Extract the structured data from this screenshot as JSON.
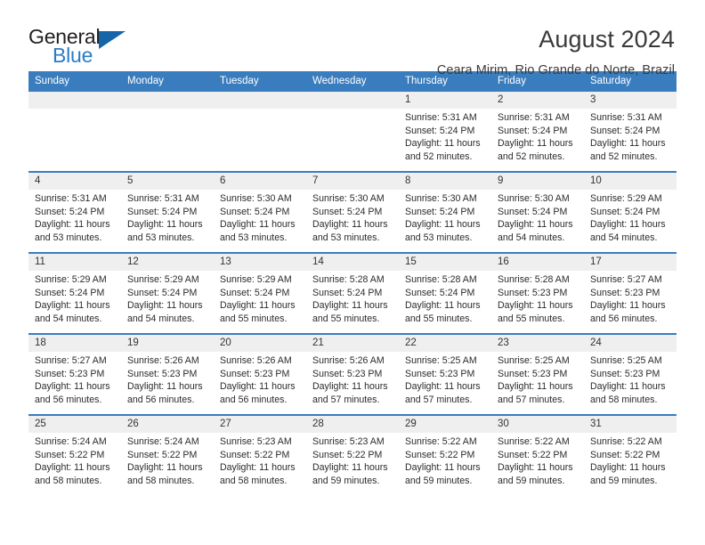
{
  "logo": {
    "word_one": "General",
    "word_two": "Blue",
    "triangle_icon": "triangle-icon",
    "brand_dark": "#231f20",
    "brand_blue": "#2b7cc4"
  },
  "header": {
    "title": "August 2024",
    "subtitle": "Ceara Mirim, Rio Grande do Norte, Brazil"
  },
  "theme": {
    "header_blue": "#3a7dbf",
    "day_band_gray": "#efefef",
    "text": "#2b2b2b"
  },
  "calendar": {
    "weekdays": [
      "Sunday",
      "Monday",
      "Tuesday",
      "Wednesday",
      "Thursday",
      "Friday",
      "Saturday"
    ],
    "weeks": [
      [
        {
          "day": "",
          "empty": true,
          "lines": []
        },
        {
          "day": "",
          "empty": true,
          "lines": []
        },
        {
          "day": "",
          "empty": true,
          "lines": []
        },
        {
          "day": "",
          "empty": true,
          "lines": []
        },
        {
          "day": "1",
          "empty": false,
          "lines": [
            "Sunrise: 5:31 AM",
            "Sunset: 5:24 PM",
            "Daylight: 11 hours",
            "and 52 minutes."
          ]
        },
        {
          "day": "2",
          "empty": false,
          "lines": [
            "Sunrise: 5:31 AM",
            "Sunset: 5:24 PM",
            "Daylight: 11 hours",
            "and 52 minutes."
          ]
        },
        {
          "day": "3",
          "empty": false,
          "lines": [
            "Sunrise: 5:31 AM",
            "Sunset: 5:24 PM",
            "Daylight: 11 hours",
            "and 52 minutes."
          ]
        }
      ],
      [
        {
          "day": "4",
          "empty": false,
          "lines": [
            "Sunrise: 5:31 AM",
            "Sunset: 5:24 PM",
            "Daylight: 11 hours",
            "and 53 minutes."
          ]
        },
        {
          "day": "5",
          "empty": false,
          "lines": [
            "Sunrise: 5:31 AM",
            "Sunset: 5:24 PM",
            "Daylight: 11 hours",
            "and 53 minutes."
          ]
        },
        {
          "day": "6",
          "empty": false,
          "lines": [
            "Sunrise: 5:30 AM",
            "Sunset: 5:24 PM",
            "Daylight: 11 hours",
            "and 53 minutes."
          ]
        },
        {
          "day": "7",
          "empty": false,
          "lines": [
            "Sunrise: 5:30 AM",
            "Sunset: 5:24 PM",
            "Daylight: 11 hours",
            "and 53 minutes."
          ]
        },
        {
          "day": "8",
          "empty": false,
          "lines": [
            "Sunrise: 5:30 AM",
            "Sunset: 5:24 PM",
            "Daylight: 11 hours",
            "and 53 minutes."
          ]
        },
        {
          "day": "9",
          "empty": false,
          "lines": [
            "Sunrise: 5:30 AM",
            "Sunset: 5:24 PM",
            "Daylight: 11 hours",
            "and 54 minutes."
          ]
        },
        {
          "day": "10",
          "empty": false,
          "lines": [
            "Sunrise: 5:29 AM",
            "Sunset: 5:24 PM",
            "Daylight: 11 hours",
            "and 54 minutes."
          ]
        }
      ],
      [
        {
          "day": "11",
          "empty": false,
          "lines": [
            "Sunrise: 5:29 AM",
            "Sunset: 5:24 PM",
            "Daylight: 11 hours",
            "and 54 minutes."
          ]
        },
        {
          "day": "12",
          "empty": false,
          "lines": [
            "Sunrise: 5:29 AM",
            "Sunset: 5:24 PM",
            "Daylight: 11 hours",
            "and 54 minutes."
          ]
        },
        {
          "day": "13",
          "empty": false,
          "lines": [
            "Sunrise: 5:29 AM",
            "Sunset: 5:24 PM",
            "Daylight: 11 hours",
            "and 55 minutes."
          ]
        },
        {
          "day": "14",
          "empty": false,
          "lines": [
            "Sunrise: 5:28 AM",
            "Sunset: 5:24 PM",
            "Daylight: 11 hours",
            "and 55 minutes."
          ]
        },
        {
          "day": "15",
          "empty": false,
          "lines": [
            "Sunrise: 5:28 AM",
            "Sunset: 5:24 PM",
            "Daylight: 11 hours",
            "and 55 minutes."
          ]
        },
        {
          "day": "16",
          "empty": false,
          "lines": [
            "Sunrise: 5:28 AM",
            "Sunset: 5:23 PM",
            "Daylight: 11 hours",
            "and 55 minutes."
          ]
        },
        {
          "day": "17",
          "empty": false,
          "lines": [
            "Sunrise: 5:27 AM",
            "Sunset: 5:23 PM",
            "Daylight: 11 hours",
            "and 56 minutes."
          ]
        }
      ],
      [
        {
          "day": "18",
          "empty": false,
          "lines": [
            "Sunrise: 5:27 AM",
            "Sunset: 5:23 PM",
            "Daylight: 11 hours",
            "and 56 minutes."
          ]
        },
        {
          "day": "19",
          "empty": false,
          "lines": [
            "Sunrise: 5:26 AM",
            "Sunset: 5:23 PM",
            "Daylight: 11 hours",
            "and 56 minutes."
          ]
        },
        {
          "day": "20",
          "empty": false,
          "lines": [
            "Sunrise: 5:26 AM",
            "Sunset: 5:23 PM",
            "Daylight: 11 hours",
            "and 56 minutes."
          ]
        },
        {
          "day": "21",
          "empty": false,
          "lines": [
            "Sunrise: 5:26 AM",
            "Sunset: 5:23 PM",
            "Daylight: 11 hours",
            "and 57 minutes."
          ]
        },
        {
          "day": "22",
          "empty": false,
          "lines": [
            "Sunrise: 5:25 AM",
            "Sunset: 5:23 PM",
            "Daylight: 11 hours",
            "and 57 minutes."
          ]
        },
        {
          "day": "23",
          "empty": false,
          "lines": [
            "Sunrise: 5:25 AM",
            "Sunset: 5:23 PM",
            "Daylight: 11 hours",
            "and 57 minutes."
          ]
        },
        {
          "day": "24",
          "empty": false,
          "lines": [
            "Sunrise: 5:25 AM",
            "Sunset: 5:23 PM",
            "Daylight: 11 hours",
            "and 58 minutes."
          ]
        }
      ],
      [
        {
          "day": "25",
          "empty": false,
          "lines": [
            "Sunrise: 5:24 AM",
            "Sunset: 5:22 PM",
            "Daylight: 11 hours",
            "and 58 minutes."
          ]
        },
        {
          "day": "26",
          "empty": false,
          "lines": [
            "Sunrise: 5:24 AM",
            "Sunset: 5:22 PM",
            "Daylight: 11 hours",
            "and 58 minutes."
          ]
        },
        {
          "day": "27",
          "empty": false,
          "lines": [
            "Sunrise: 5:23 AM",
            "Sunset: 5:22 PM",
            "Daylight: 11 hours",
            "and 58 minutes."
          ]
        },
        {
          "day": "28",
          "empty": false,
          "lines": [
            "Sunrise: 5:23 AM",
            "Sunset: 5:22 PM",
            "Daylight: 11 hours",
            "and 59 minutes."
          ]
        },
        {
          "day": "29",
          "empty": false,
          "lines": [
            "Sunrise: 5:22 AM",
            "Sunset: 5:22 PM",
            "Daylight: 11 hours",
            "and 59 minutes."
          ]
        },
        {
          "day": "30",
          "empty": false,
          "lines": [
            "Sunrise: 5:22 AM",
            "Sunset: 5:22 PM",
            "Daylight: 11 hours",
            "and 59 minutes."
          ]
        },
        {
          "day": "31",
          "empty": false,
          "lines": [
            "Sunrise: 5:22 AM",
            "Sunset: 5:22 PM",
            "Daylight: 11 hours",
            "and 59 minutes."
          ]
        }
      ]
    ]
  }
}
